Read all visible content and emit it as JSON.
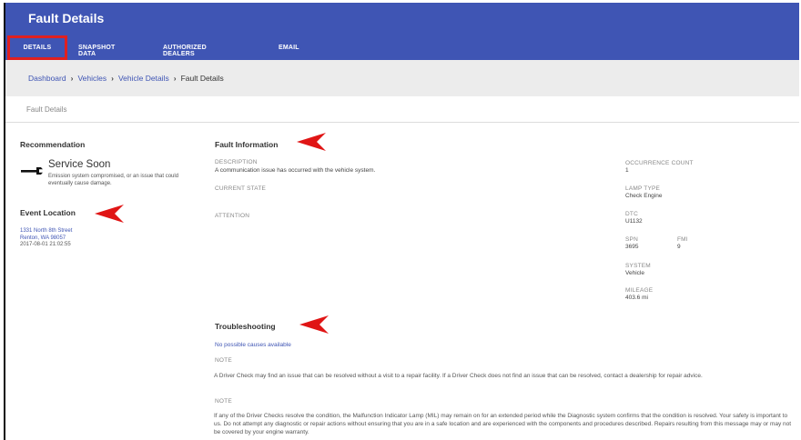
{
  "app": {
    "title": "Fault Details"
  },
  "tabs": [
    {
      "label": "DETAILS"
    },
    {
      "label": "SNAPSHOT DATA"
    },
    {
      "label": "AUTHORIZED DEALERS"
    },
    {
      "label": "EMAIL"
    }
  ],
  "breadcrumb": {
    "items": [
      "Dashboard",
      "Vehicles",
      "Vehicle Details"
    ],
    "current": "Fault Details",
    "separator": "›"
  },
  "subheader": {
    "title": "Fault Details"
  },
  "recommendation": {
    "heading": "Recommendation",
    "title": "Service Soon",
    "description": "Emission system compromised, or an issue that could eventually cause damage.",
    "icon": "wrench-icon"
  },
  "event_location": {
    "heading": "Event Location",
    "address_line1": "1331 North 8th Street",
    "address_line2": "Renton, WA 98057",
    "timestamp": "2017-08-01 21:02:55"
  },
  "fault_info": {
    "heading": "Fault Information",
    "description_label": "DESCRIPTION",
    "description_value": "A communication issue has occurred with the vehicle system.",
    "current_state_label": "CURRENT STATE",
    "attention_label": "ATTENTION",
    "occurrence_label": "OCCURRENCE COUNT",
    "occurrence_value": "1",
    "lamp_label": "LAMP TYPE",
    "lamp_value": "Check Engine",
    "dtc_label": "DTC",
    "dtc_value": "U1132",
    "spn_label": "SPN",
    "spn_value": "3695",
    "fmi_label": "FMI",
    "fmi_value": "9",
    "system_label": "SYSTEM",
    "system_value": "Vehicle",
    "mileage_label": "MILEAGE",
    "mileage_value": "403.6 mi"
  },
  "troubleshooting": {
    "heading": "Troubleshooting",
    "causes_link": "No possible causes available",
    "note1_label": "NOTE",
    "note1_text": "A Driver Check may find an issue that can be resolved without a visit to a repair facility. If a Driver Check does not find an issue that can be resolved, contact a dealership for repair advice.",
    "note2_label": "NOTE",
    "note2_text": "If any of the Driver Checks resolve the condition, the Malfunction Indicator Lamp (MIL) may remain on for an extended period while the Diagnostic system confirms that the condition is resolved. Your safety is important to us. Do not attempt any diagnostic or repair actions without ensuring that you are in a safe location and are experienced with the components and procedures described. Repairs resulting from this message may or may not be covered by your engine warranty."
  },
  "colors": {
    "header": "#3f55b4",
    "highlight": "#e02020",
    "link": "#3f55b4"
  }
}
